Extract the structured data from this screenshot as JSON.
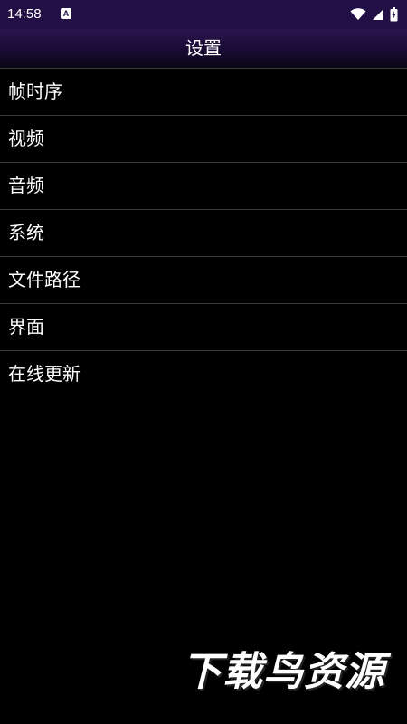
{
  "status_bar": {
    "time": "14:58",
    "notification_glyph": "A",
    "icons": [
      "wifi-icon",
      "signal-icon",
      "battery-icon"
    ]
  },
  "header": {
    "title": "设置"
  },
  "menu": {
    "items": [
      {
        "label": "帧时序"
      },
      {
        "label": "视频"
      },
      {
        "label": "音频"
      },
      {
        "label": "系统"
      },
      {
        "label": "文件路径"
      },
      {
        "label": "界面"
      },
      {
        "label": "在线更新"
      }
    ]
  },
  "watermark": {
    "text": "下载鸟资源"
  },
  "colors": {
    "status_bar_bg": "#220f45",
    "title_bar_bg": "#190b33",
    "background": "#000000",
    "divider": "#3a3a3a",
    "text": "#ffffff"
  }
}
